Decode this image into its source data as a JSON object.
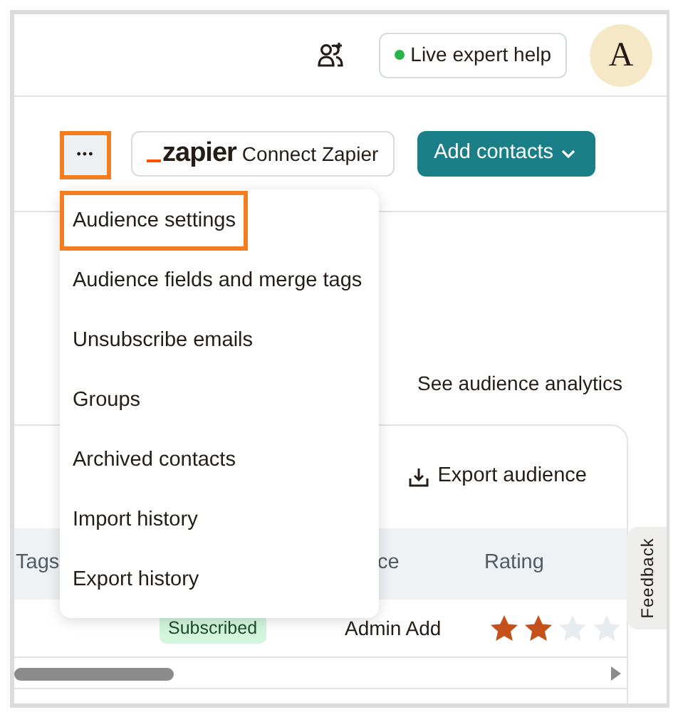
{
  "header": {
    "help_button": "Live expert help",
    "avatar": "A"
  },
  "toolbar": {
    "more_button": {
      "label": "•••",
      "highlighted": true
    },
    "zapier_logo": "zapier",
    "zapier_button": "Connect Zapier",
    "add_button": "Add contacts"
  },
  "menu": [
    {
      "label": "Audience settings",
      "highlighted": true
    },
    {
      "label": "Audience fields and merge tags",
      "highlighted": false
    },
    {
      "label": "Unsubscribe emails",
      "highlighted": false
    },
    {
      "label": "Groups",
      "highlighted": false
    },
    {
      "label": "Archived contacts",
      "highlighted": false
    },
    {
      "label": "Import history",
      "highlighted": false
    },
    {
      "label": "Export history",
      "highlighted": false
    }
  ],
  "analytics_link": "See audience analytics",
  "export_button": "Export audience",
  "table": {
    "columns": [
      "Tags",
      "",
      "ce",
      "Rating"
    ],
    "rows": [
      {
        "status": "Subscribed",
        "source": "Admin Add",
        "stars": 2
      }
    ]
  },
  "feedback_tab": "Feedback"
}
